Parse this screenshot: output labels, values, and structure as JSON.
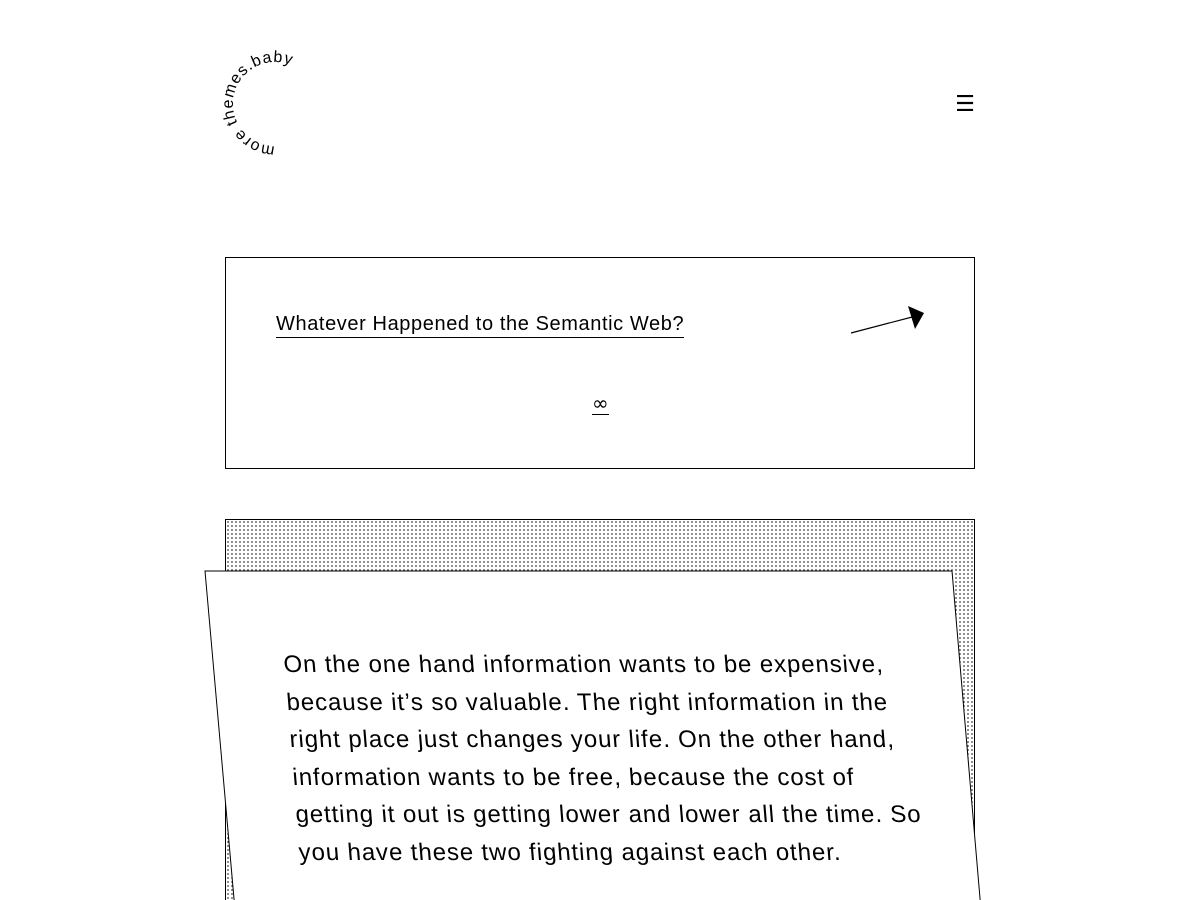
{
  "header": {
    "logo_text": "more themes.baby",
    "menu_icon": "hamburger-icon",
    "menu_glyph": "☰"
  },
  "link_card": {
    "title": "Whatever Happened to the Semantic Web?",
    "arrow_icon": "arrow-up-right-icon",
    "permalink": "∞"
  },
  "quote": {
    "text": "On the one hand information wants to be expensive, because it’s so valuable. The right information in the right place just changes your life. On the other hand, information wants to be free, because the cost of getting it out is getting lower and lower all the time. So you have these two fighting against each other."
  }
}
